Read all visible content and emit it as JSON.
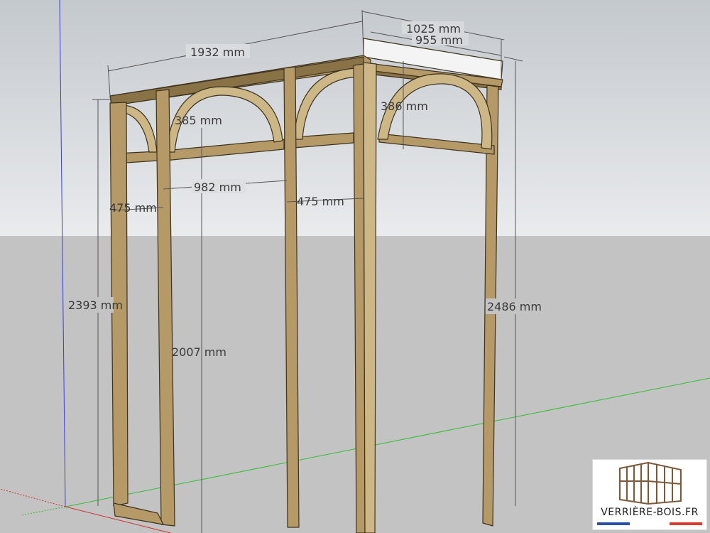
{
  "colors": {
    "sky_top": "#c4c9ce",
    "sky_bottom": "#e9ebed",
    "ground": "#c3c3c3",
    "wood_face": "#b59a67",
    "wood_light": "#cdb787",
    "wood_dark": "#8a7247",
    "wood_edge": "#3d321f",
    "dimension_line": "#555555",
    "axis_blue": "#3a3ae0",
    "axis_green": "#2fbf2f",
    "axis_red": "#d03030",
    "flag_blue": "#2b4fa8",
    "flag_red": "#d83a2e"
  },
  "dimensions": {
    "overall_width": "1932 mm",
    "depth_outer": "1025 mm",
    "depth_inner": "955 mm",
    "arch_height_left": "385 mm",
    "arch_height_right": "386 mm",
    "door_opening": "982 mm",
    "panel_left": "475 mm",
    "panel_right": "475 mm",
    "height_left": "2393 mm",
    "door_height": "2007 mm",
    "height_right": "2486 mm"
  },
  "logo": {
    "text": "VERRIÈRE-BOIS.FR",
    "icon": "greenhouse-icon"
  }
}
